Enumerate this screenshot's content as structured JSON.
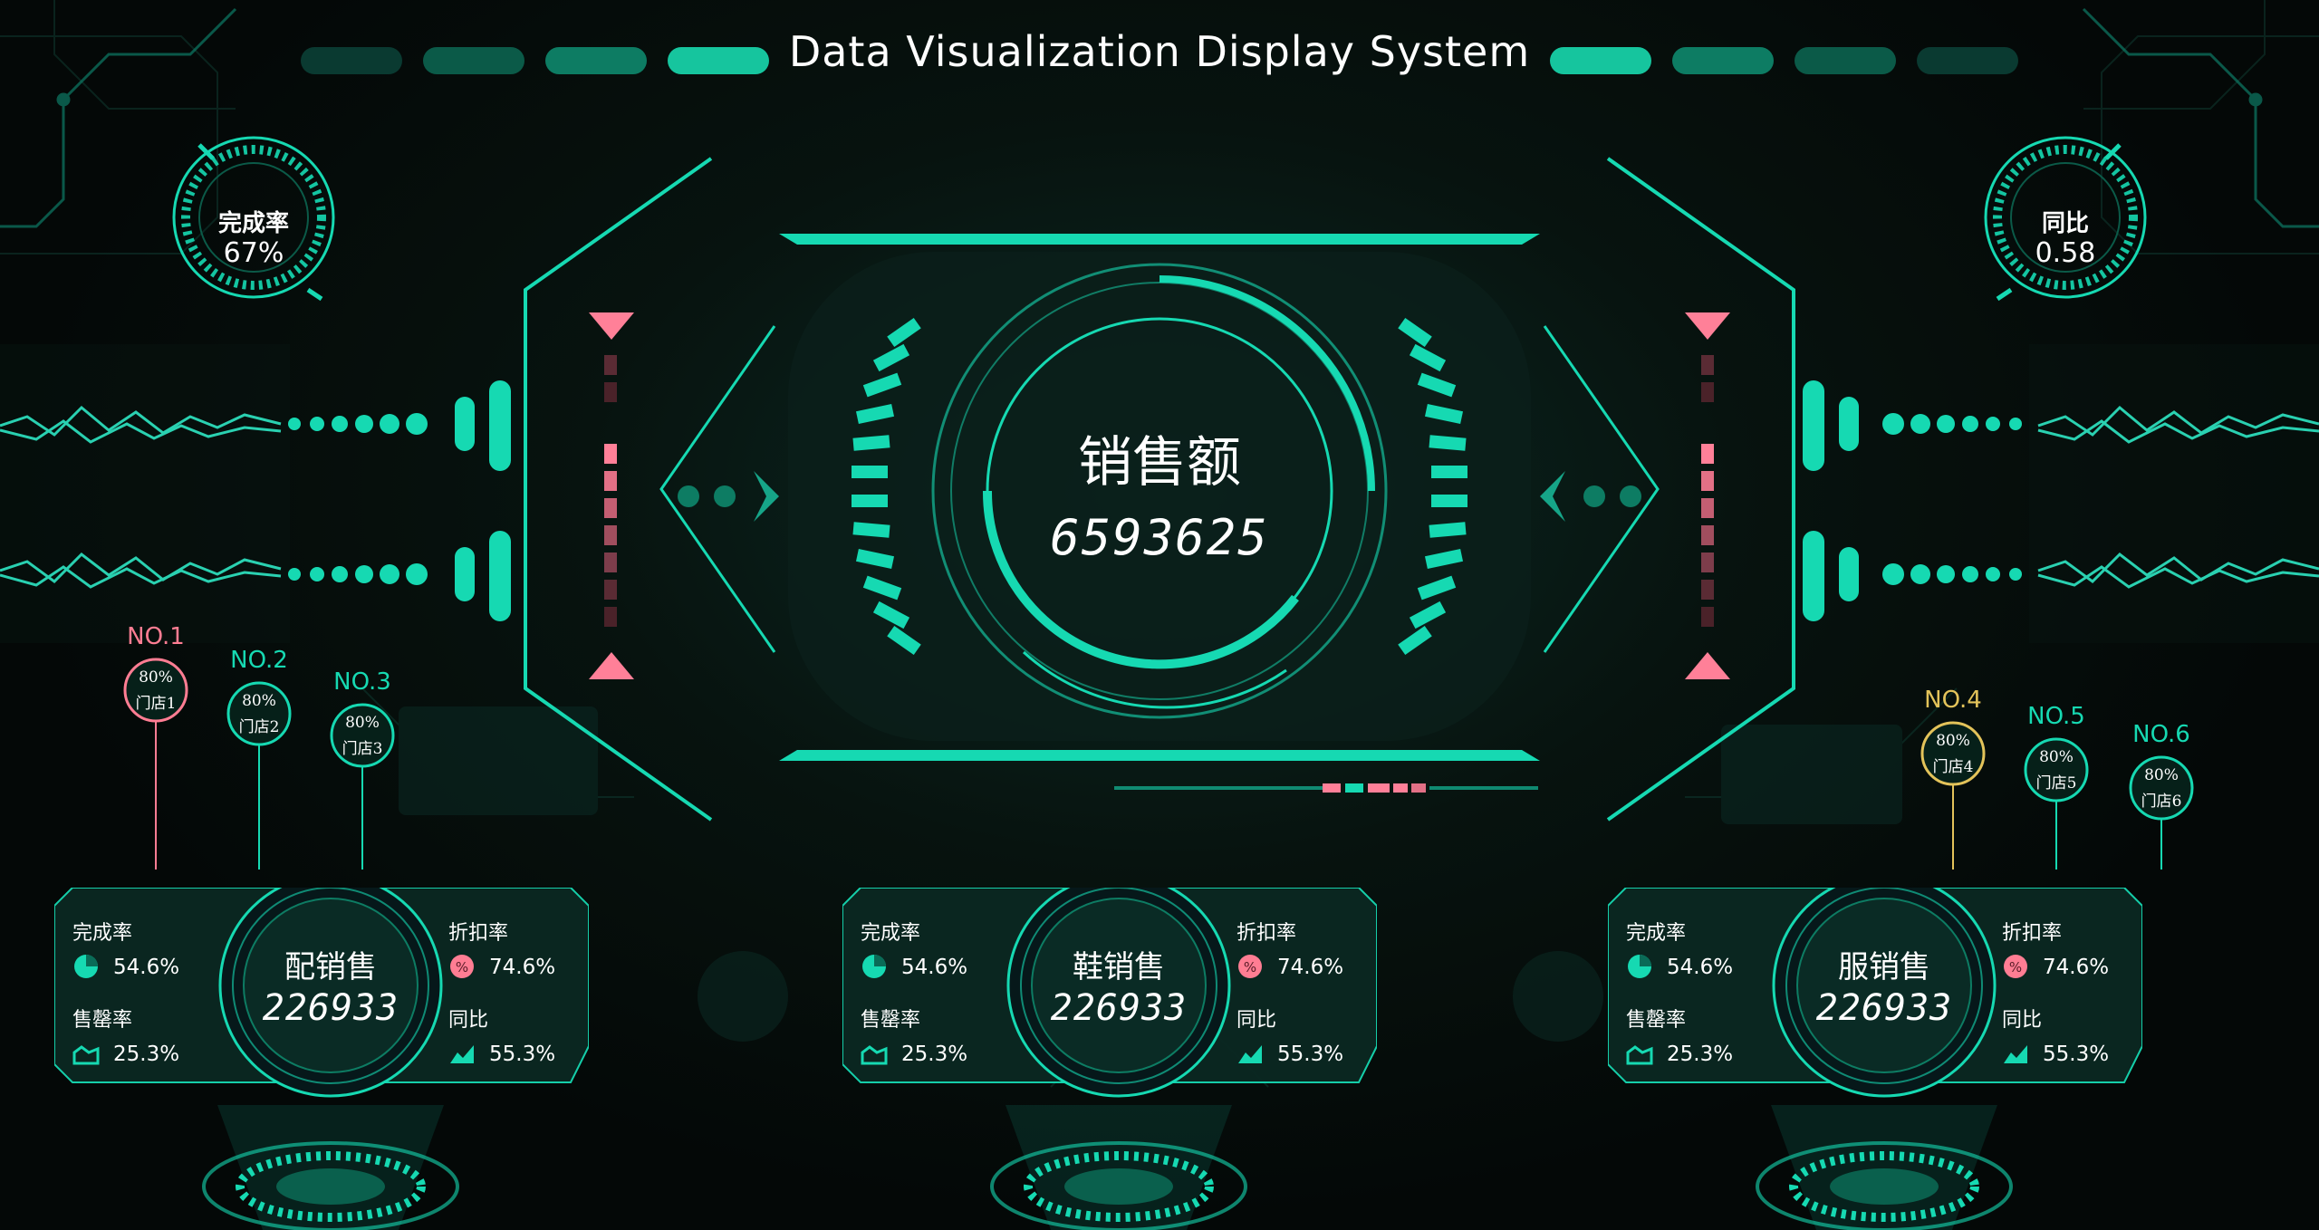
{
  "header": {
    "title": "Data Visualization Display System"
  },
  "colors": {
    "accent": "#16d9b2",
    "accent_dark": "#0a6b57",
    "pink": "#ff7d93",
    "yellow": "#e3c35a",
    "bg": "#050908"
  },
  "gauges": {
    "left": {
      "label": "完成率",
      "value": "67%",
      "fraction": 0.67
    },
    "right": {
      "label": "同比",
      "value": "0.58"
    }
  },
  "center": {
    "label": "销售额",
    "value": "6593625"
  },
  "stores": [
    {
      "no": "NO.1",
      "pct": "80%",
      "name": "门店1",
      "color": "#ff7d93"
    },
    {
      "no": "NO.2",
      "pct": "80%",
      "name": "门店2",
      "color": "#16d9b2"
    },
    {
      "no": "NO.3",
      "pct": "80%",
      "name": "门店3",
      "color": "#16d9b2"
    },
    {
      "no": "NO.4",
      "pct": "80%",
      "name": "门店4",
      "color": "#e3c35a"
    },
    {
      "no": "NO.5",
      "pct": "80%",
      "name": "门店5",
      "color": "#16d9b2"
    },
    {
      "no": "NO.6",
      "pct": "80%",
      "name": "门店6",
      "color": "#16d9b2"
    }
  ],
  "cards": [
    {
      "title": "配销售",
      "value": "226933",
      "stats": [
        {
          "label": "完成率",
          "value": "54.6%",
          "icon": "pie-icon"
        },
        {
          "label": "折扣率",
          "value": "74.6%",
          "icon": "percent-icon"
        },
        {
          "label": "售罄率",
          "value": "25.3%",
          "icon": "area-icon"
        },
        {
          "label": "同比",
          "value": "55.3%",
          "icon": "trend-icon"
        }
      ]
    },
    {
      "title": "鞋销售",
      "value": "226933",
      "stats": [
        {
          "label": "完成率",
          "value": "54.6%",
          "icon": "pie-icon"
        },
        {
          "label": "折扣率",
          "value": "74.6%",
          "icon": "percent-icon"
        },
        {
          "label": "售罄率",
          "value": "25.3%",
          "icon": "area-icon"
        },
        {
          "label": "同比",
          "value": "55.3%",
          "icon": "trend-icon"
        }
      ]
    },
    {
      "title": "服销售",
      "value": "226933",
      "stats": [
        {
          "label": "完成率",
          "value": "54.6%",
          "icon": "pie-icon"
        },
        {
          "label": "折扣率",
          "value": "74.6%",
          "icon": "percent-icon"
        },
        {
          "label": "售罄率",
          "value": "25.3%",
          "icon": "area-icon"
        },
        {
          "label": "同比",
          "value": "55.3%",
          "icon": "trend-icon"
        }
      ]
    }
  ]
}
